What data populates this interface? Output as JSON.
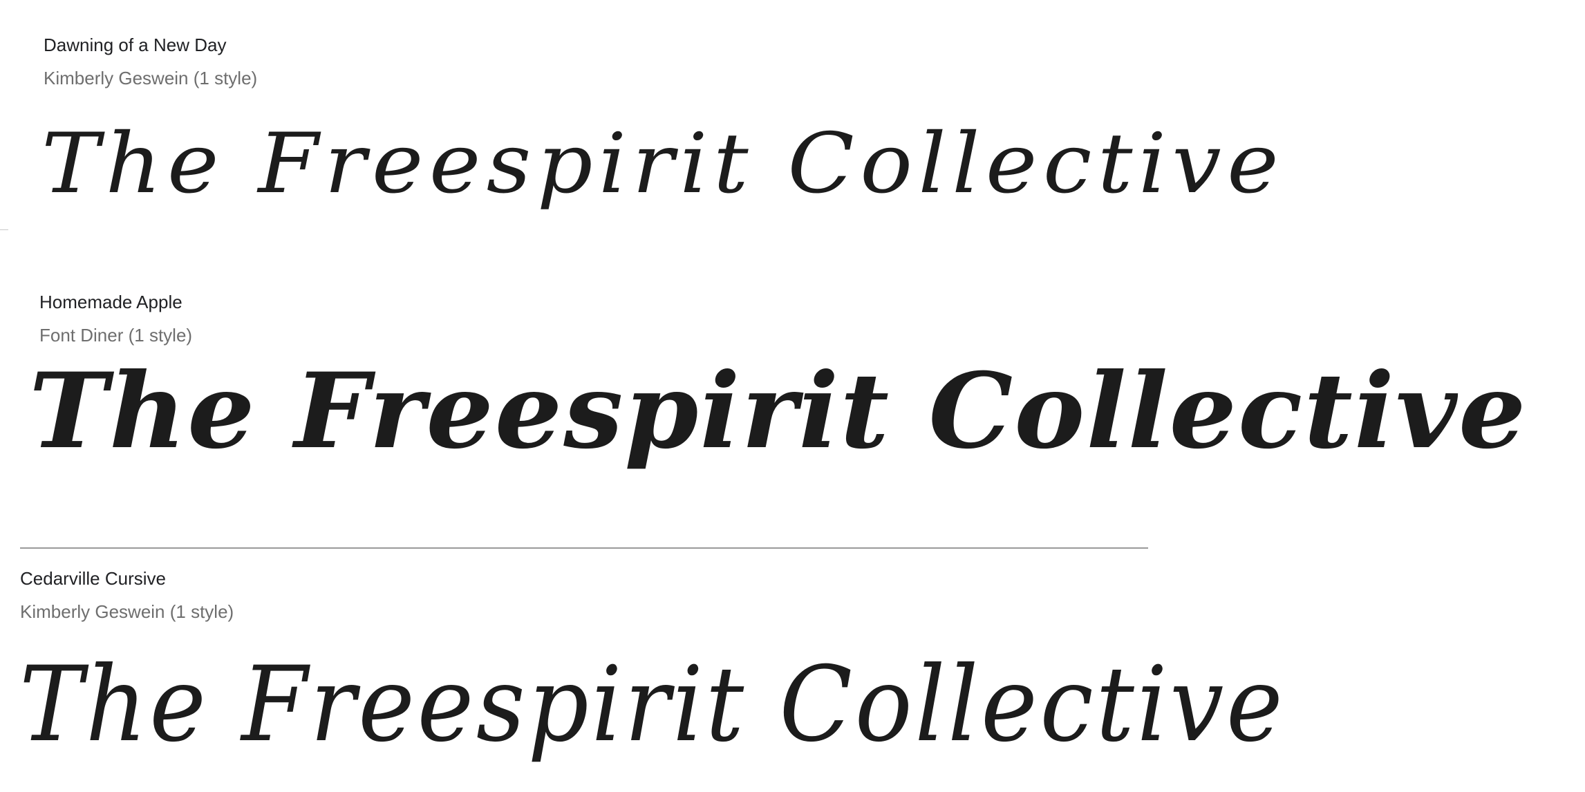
{
  "fonts": [
    {
      "name": "Dawning of a New Day",
      "meta": "Kimberly Geswein (1 style)",
      "sample": "The Freespirit Collective"
    },
    {
      "name": "Homemade Apple",
      "meta": "Font Diner (1 style)",
      "sample": "The Freespirit Collective"
    },
    {
      "name": "Cedarville Cursive",
      "meta": "Kimberly Geswein (1 style)",
      "sample": "The Freespirit Collective"
    }
  ]
}
